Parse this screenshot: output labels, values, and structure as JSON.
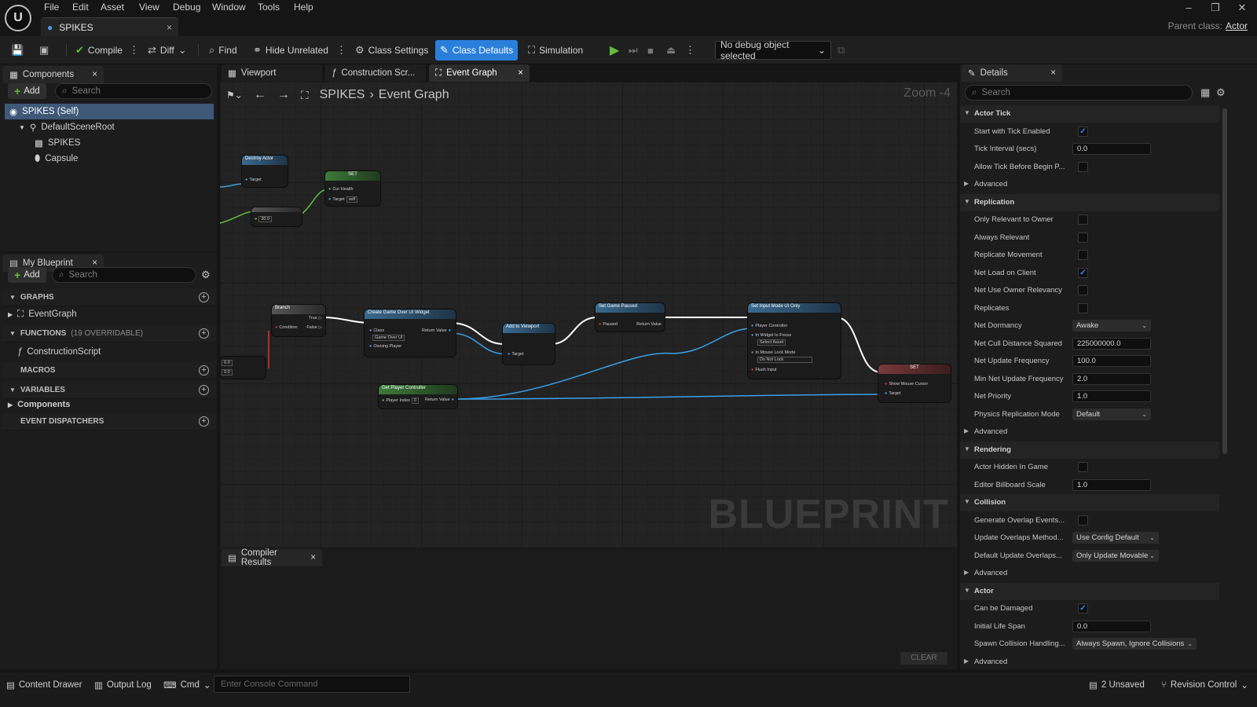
{
  "menu": [
    "File",
    "Edit",
    "Asset",
    "View",
    "Debug",
    "Window",
    "Tools",
    "Help"
  ],
  "doc_tab": "SPIKES",
  "parent_class": {
    "label": "Parent class:",
    "value": "Actor"
  },
  "toolbar": {
    "compile": "Compile",
    "diff": "Diff",
    "find": "Find",
    "hide_unrelated": "Hide Unrelated",
    "class_settings": "Class Settings",
    "class_defaults": "Class Defaults",
    "simulation": "Simulation",
    "debug_object": "No debug object selected"
  },
  "components": {
    "tab": "Components",
    "add": "Add",
    "search_placeholder": "Search",
    "items": [
      "SPIKES (Self)",
      "DefaultSceneRoot",
      "SPIKES",
      "Capsule"
    ]
  },
  "my_blueprint": {
    "tab": "My Blueprint",
    "add": "Add",
    "search_placeholder": "Search",
    "graphs": "GRAPHS",
    "event_graph": "EventGraph",
    "functions": "FUNCTIONS",
    "functions_count": "(19 OVERRIDABLE)",
    "construction_script": "ConstructionScript",
    "macros": "MACROS",
    "variables": "VARIABLES",
    "components_item": "Components",
    "event_dispatchers": "EVENT DISPATCHERS"
  },
  "editor_tabs": [
    "Viewport",
    "Construction Scr...",
    "Event Graph"
  ],
  "breadcrumb": {
    "root": "SPIKES",
    "current": "Event Graph"
  },
  "zoom_label": "Zoom -4",
  "watermark": "BLUEPRINT",
  "nodes": {
    "destroy_actor": {
      "title": "Destroy Actor",
      "target": "Target"
    },
    "set_top": {
      "title": "SET",
      "pin1": "Cur Health",
      "target": "Target",
      "self": "self"
    },
    "float": "30.0",
    "branch": {
      "title": "Branch",
      "cond": "Condition",
      "t": "True",
      "f": "False"
    },
    "create_widget": {
      "title": "Create Game Over UI Widget",
      "cls": "Class",
      "cls_val": "Game Over UI",
      "owner": "Owning Player",
      "ret": "Return Value"
    },
    "add_viewport": {
      "title": "Add to Viewport",
      "target": "Target"
    },
    "set_paused": {
      "title": "Set Game Paused",
      "paused": "Paused",
      "ret": "Return Value"
    },
    "set_input": {
      "title": "Set Input Mode UI Only",
      "pc": "Player Controller",
      "widget": "In Widget to Focus",
      "widget_val": "Select Asset",
      "lock": "In Mouse Lock Mode",
      "lock_val": "Do Not Lock",
      "flush": "Flush Input"
    },
    "get_pc": {
      "title": "Get Player Controller",
      "idx": "Player Index",
      "idx_val": "0",
      "ret": "Return Value"
    },
    "set_right": {
      "title": "SET",
      "cursor": "Show Mouse Cursor",
      "target": "Target"
    },
    "lt": {
      "a": "0.0",
      "b": "0.0"
    }
  },
  "compiler": {
    "tab": "Compiler Results",
    "clear": "CLEAR"
  },
  "details": {
    "tab": "Details",
    "search_placeholder": "Search",
    "sections": [
      {
        "title": "Actor Tick",
        "rows": [
          {
            "label": "Start with Tick Enabled",
            "type": "check",
            "value": true
          },
          {
            "label": "Tick Interval (secs)",
            "type": "num",
            "value": "0.0"
          },
          {
            "label": "Allow Tick Before Begin P...",
            "type": "check",
            "value": false
          },
          {
            "label": "Advanced",
            "type": "adv"
          }
        ]
      },
      {
        "title": "Replication",
        "rows": [
          {
            "label": "Only Relevant to Owner",
            "type": "check",
            "value": false
          },
          {
            "label": "Always Relevant",
            "type": "check",
            "value": false
          },
          {
            "label": "Replicate Movement",
            "type": "check",
            "value": false
          },
          {
            "label": "Net Load on Client",
            "type": "check",
            "value": true
          },
          {
            "label": "Net Use Owner Relevancy",
            "type": "check",
            "value": false
          },
          {
            "label": "Replicates",
            "type": "check",
            "value": false
          },
          {
            "label": "Net Dormancy",
            "type": "drop",
            "value": "Awake"
          },
          {
            "label": "Net Cull Distance Squared",
            "type": "num",
            "value": "225000000.0"
          },
          {
            "label": "Net Update Frequency",
            "type": "num",
            "value": "100.0"
          },
          {
            "label": "Min Net Update Frequency",
            "type": "num",
            "value": "2.0"
          },
          {
            "label": "Net Priority",
            "type": "num",
            "value": "1.0"
          },
          {
            "label": "Physics Replication Mode",
            "type": "drop",
            "value": "Default"
          },
          {
            "label": "Advanced",
            "type": "adv"
          }
        ]
      },
      {
        "title": "Rendering",
        "rows": [
          {
            "label": "Actor Hidden In Game",
            "type": "check",
            "value": false
          },
          {
            "label": "Editor Billboard Scale",
            "type": "num",
            "value": "1.0"
          }
        ]
      },
      {
        "title": "Collision",
        "rows": [
          {
            "label": "Generate Overlap Events...",
            "type": "check",
            "value": false
          },
          {
            "label": "Update Overlaps Method...",
            "type": "drop",
            "value": "Use Config Default"
          },
          {
            "label": "Default Update Overlaps...",
            "type": "drop",
            "value": "Only Update Movable"
          },
          {
            "label": "Advanced",
            "type": "adv"
          }
        ]
      },
      {
        "title": "Actor",
        "rows": [
          {
            "label": "Can be Damaged",
            "type": "check",
            "value": true
          },
          {
            "label": "Initial Life Span",
            "type": "num",
            "value": "0.0"
          },
          {
            "label": "Spawn Collision Handling...",
            "type": "drop",
            "value": "Always Spawn, Ignore Collisions"
          },
          {
            "label": "Advanced",
            "type": "adv"
          }
        ]
      }
    ]
  },
  "statusbar": {
    "content_drawer": "Content Drawer",
    "output_log": "Output Log",
    "cmd": "Cmd",
    "console_placeholder": "Enter Console Command",
    "unsaved": "2 Unsaved",
    "revision_control": "Revision Control"
  }
}
